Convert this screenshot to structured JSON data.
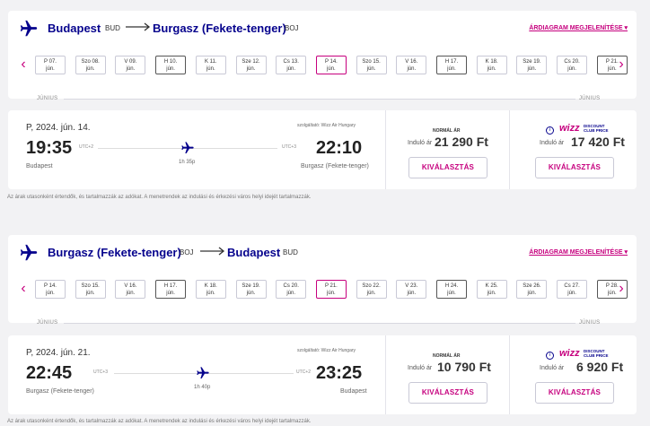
{
  "routes": [
    {
      "origin_city": "Budapest",
      "origin_code": "BUD",
      "dest_city": "Burgasz (Fekete-tenger)",
      "dest_code": "BOJ",
      "map_link": "ÁRDIAGRAM MEGJELENÍTÉSE",
      "month_label": "JÚNIUS",
      "dates": [
        {
          "day": "P 07.",
          "month": "jún."
        },
        {
          "day": "Szo 08.",
          "month": "jún."
        },
        {
          "day": "V 09.",
          "month": "jún."
        },
        {
          "day": "H 10.",
          "month": "jún."
        },
        {
          "day": "K 11.",
          "month": "jún."
        },
        {
          "day": "Sze 12.",
          "month": "jún."
        },
        {
          "day": "Cs 13.",
          "month": "jún."
        },
        {
          "day": "P 14.",
          "month": "jún."
        },
        {
          "day": "Szo 15.",
          "month": "jún."
        },
        {
          "day": "V 16.",
          "month": "jún."
        },
        {
          "day": "H 17.",
          "month": "jún."
        },
        {
          "day": "K 18.",
          "month": "jún."
        },
        {
          "day": "Sze 19.",
          "month": "jún."
        },
        {
          "day": "Cs 20.",
          "month": "jún."
        },
        {
          "day": "P 21.",
          "month": "jún."
        }
      ],
      "flight": {
        "date": "P, 2024. jún. 14.",
        "operator": "szolgáltató: Wizz Air Hungary",
        "dep_time": "19:35",
        "dep_utc": "UTC+2",
        "arr_time": "22:10",
        "arr_utc": "UTC+3",
        "duration": "1h 35p",
        "dep_place": "Budapest",
        "arr_place": "Burgasz (Fekete-tenger)"
      },
      "fare_normal": {
        "label": "NORMÁL ÁR",
        "from": "Induló ár",
        "price": "21 290 Ft",
        "button": "KIVÁLASZTÁS"
      },
      "fare_club": {
        "logo": "wizz",
        "line1": "DISCOUNT",
        "line2": "CLUB PRICE",
        "from": "Induló ár",
        "price": "17 420 Ft",
        "button": "KIVÁLASZTÁS"
      },
      "note": "Az árak utasonként értendők, és tartalmazzák az adókat. A menetrendek az indulási és érkezési város helyi idejét tartalmazzák."
    },
    {
      "origin_city": "Burgasz (Fekete-tenger)",
      "origin_code": "BOJ",
      "dest_city": "Budapest",
      "dest_code": "BUD",
      "map_link": "ÁRDIAGRAM MEGJELENÍTÉSE",
      "month_label": "JÚNIUS",
      "dates": [
        {
          "day": "P 14.",
          "month": "jún."
        },
        {
          "day": "Szo 15.",
          "month": "jún."
        },
        {
          "day": "V 16.",
          "month": "jún."
        },
        {
          "day": "H 17.",
          "month": "jún."
        },
        {
          "day": "K 18.",
          "month": "jún."
        },
        {
          "day": "Sze 19.",
          "month": "jún."
        },
        {
          "day": "Cs 20.",
          "month": "jún."
        },
        {
          "day": "P 21.",
          "month": "jún."
        },
        {
          "day": "Szo 22.",
          "month": "jún."
        },
        {
          "day": "V 23.",
          "month": "jún."
        },
        {
          "day": "H 24.",
          "month": "jún."
        },
        {
          "day": "K 25.",
          "month": "jún."
        },
        {
          "day": "Sze 26.",
          "month": "jún."
        },
        {
          "day": "Cs 27.",
          "month": "jún."
        },
        {
          "day": "P 28.",
          "month": "jún."
        }
      ],
      "flight": {
        "date": "P, 2024. jún. 21.",
        "operator": "szolgáltató: Wizz Air Hungary",
        "dep_time": "22:45",
        "dep_utc": "UTC+3",
        "arr_time": "23:25",
        "arr_utc": "UTC+2",
        "duration": "1h 40p",
        "dep_place": "Burgasz (Fekete-tenger)",
        "arr_place": "Budapest"
      },
      "fare_normal": {
        "label": "NORMÁL ÁR",
        "from": "Induló ár",
        "price": "10 790 Ft",
        "button": "KIVÁLASZTÁS"
      },
      "fare_club": {
        "logo": "wizz",
        "line1": "DISCOUNT",
        "line2": "CLUB PRICE",
        "from": "Induló ár",
        "price": "6 920 Ft",
        "button": "KIVÁLASZTÁS"
      },
      "note": "Az árak utasonként értendők, és tartalmazzák az adókat. A menetrendek az indulási és érkezési város helyi idejét tartalmazzák."
    }
  ],
  "colors": {
    "brand": "#06038d",
    "accent": "#c6007e",
    "background": "#f2f2f4"
  },
  "icons": [
    "plane-icon",
    "arrow-right-icon",
    "chevron-left-icon",
    "chevron-right-icon",
    "info-icon"
  ]
}
